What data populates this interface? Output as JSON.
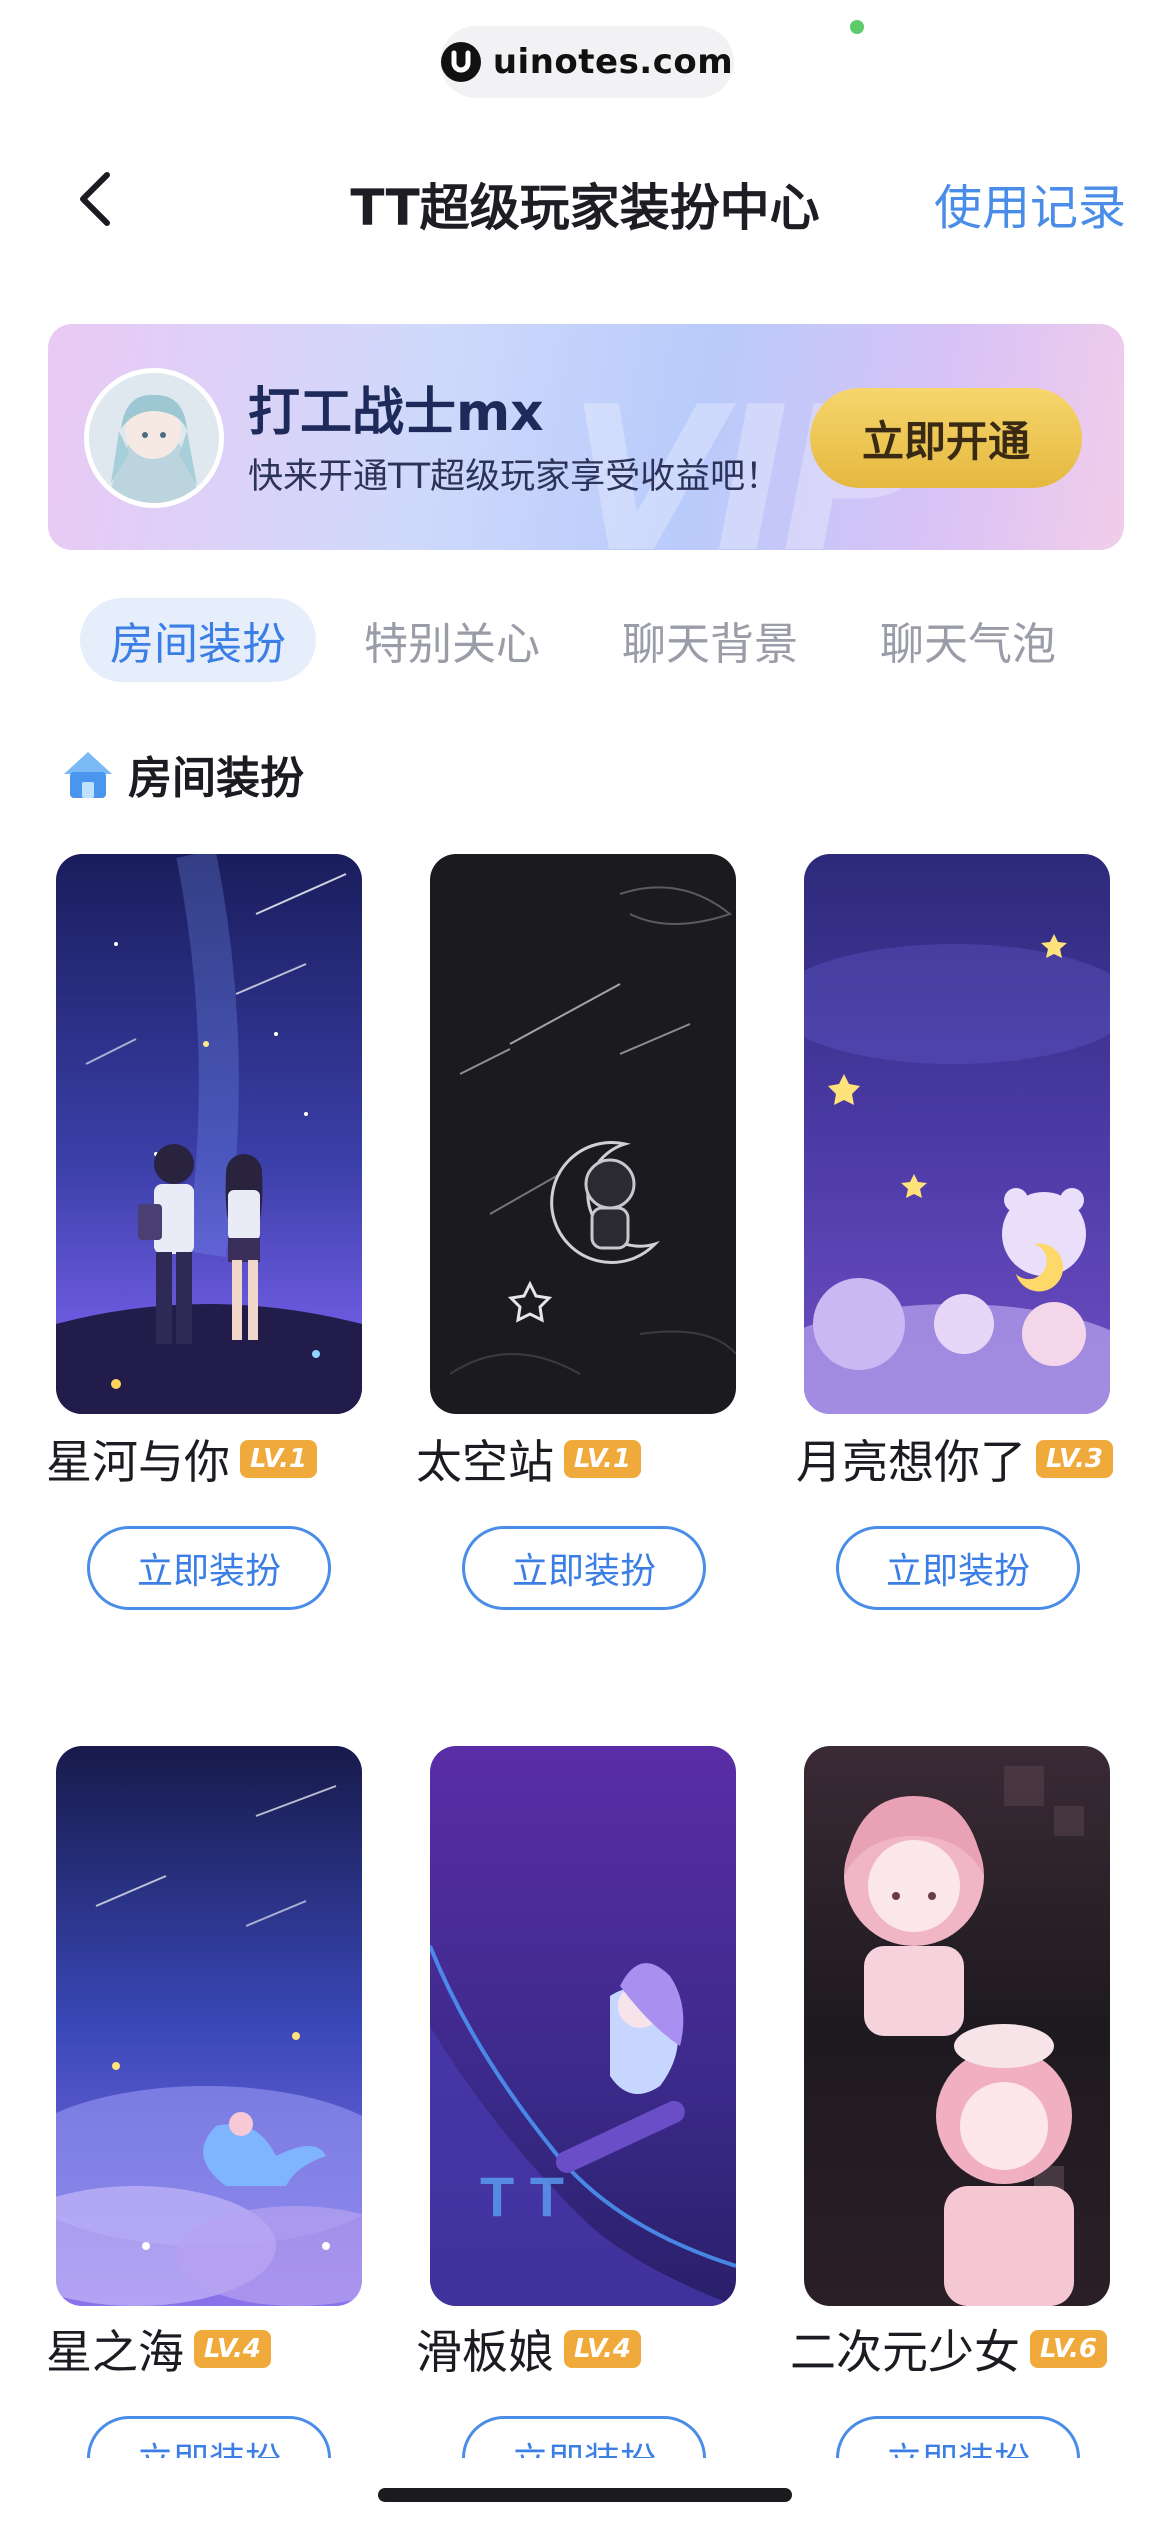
{
  "status": {
    "pill_text": "uinotes.com"
  },
  "nav": {
    "title": "TT超级玩家装扮中心",
    "record_label": "使用记录"
  },
  "banner": {
    "user_name": "打工战士mx",
    "description": "快来开通TT超级玩家享受收益吧！",
    "open_button": "立即开通",
    "watermark": "VIP"
  },
  "tabs": [
    {
      "label": "房间装扮",
      "active": true
    },
    {
      "label": "特别关心",
      "active": false
    },
    {
      "label": "聊天背景",
      "active": false
    },
    {
      "label": "聊天气泡",
      "active": false
    }
  ],
  "section": {
    "title": "房间装扮",
    "icon": "house-icon"
  },
  "cards": [
    {
      "title": "星河与你",
      "level": "LV.1",
      "button": "立即装扮"
    },
    {
      "title": "太空站",
      "level": "LV.1",
      "button": "立即装扮"
    },
    {
      "title": "月亮想你了",
      "level": "LV.3",
      "button": "立即装扮"
    },
    {
      "title": "星之海",
      "level": "LV.4",
      "button": "立即装扮"
    },
    {
      "title": "滑板娘",
      "level": "LV.4",
      "button": "立即装扮"
    },
    {
      "title": "二次元少女",
      "level": "LV.6",
      "button": "立即装扮"
    }
  ],
  "colors": {
    "accent": "#4a8de8",
    "badge": "#f0aa3c",
    "vip_button": "#eec553"
  }
}
